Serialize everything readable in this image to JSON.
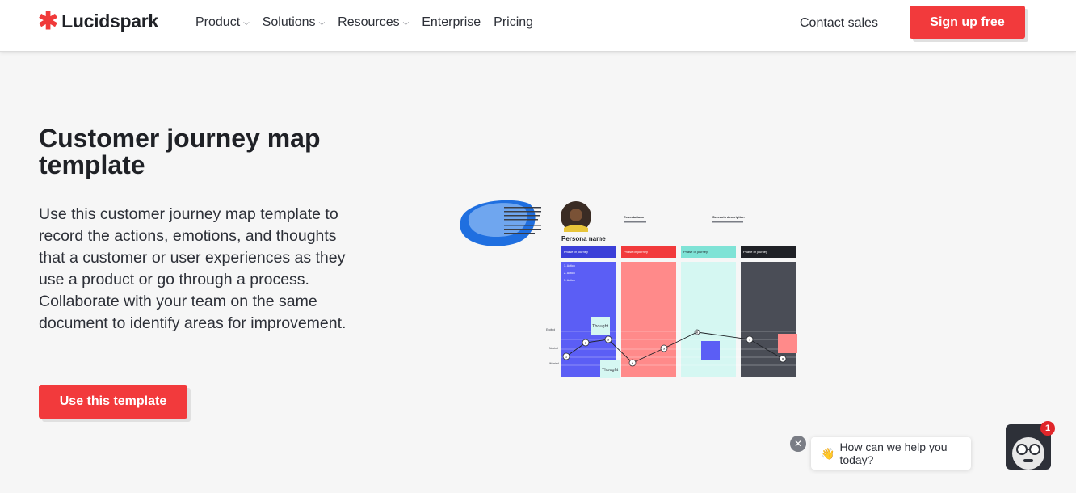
{
  "nav": {
    "logo_mark": "✱",
    "logo_text": "Lucidspark",
    "items": [
      {
        "label": "Product",
        "has_dropdown": true
      },
      {
        "label": "Solutions",
        "has_dropdown": true
      },
      {
        "label": "Resources",
        "has_dropdown": true
      },
      {
        "label": "Enterprise",
        "has_dropdown": false
      },
      {
        "label": "Pricing",
        "has_dropdown": false
      }
    ],
    "contact_label": "Contact sales",
    "signup_label": "Sign up free",
    "dropdown_icon": "chevron-down-icon"
  },
  "hero": {
    "title": "Customer journey map template",
    "description": "Use this customer journey map template to record the actions, emotions, and thoughts that a customer or user experiences as they use a product or go through a process. Collaborate with your team on the same document to identify areas for improvement.",
    "cta_label": "Use this template"
  },
  "preview": {
    "persona_name": "Persona name",
    "expectations_label": "Expectations",
    "scenario_label": "Scenario description",
    "phases": [
      {
        "label": "Phase of journey",
        "color": "#5b5ef5"
      },
      {
        "label": "Phase of journey",
        "color": "#f23a3c"
      },
      {
        "label": "Phase of journey",
        "color": "#7fe3d6"
      },
      {
        "label": "Phase of journey",
        "color": "#1f2126"
      }
    ],
    "actions": [
      "1. Action",
      "2. Action",
      "3. Action"
    ],
    "emotions": [
      "Excited",
      "Neutral",
      "Worried"
    ],
    "thought_label": "Thought",
    "journey_points": [
      "1",
      "2",
      "3",
      "4",
      "5",
      "6",
      "7",
      "8"
    ]
  },
  "chat": {
    "close_icon": "close-icon",
    "emoji": "👋",
    "message": "How can we help you today?",
    "badge_count": "1"
  },
  "colors": {
    "accent": "#f23a3c",
    "text": "#1f2126",
    "background": "#f6f6f6"
  }
}
